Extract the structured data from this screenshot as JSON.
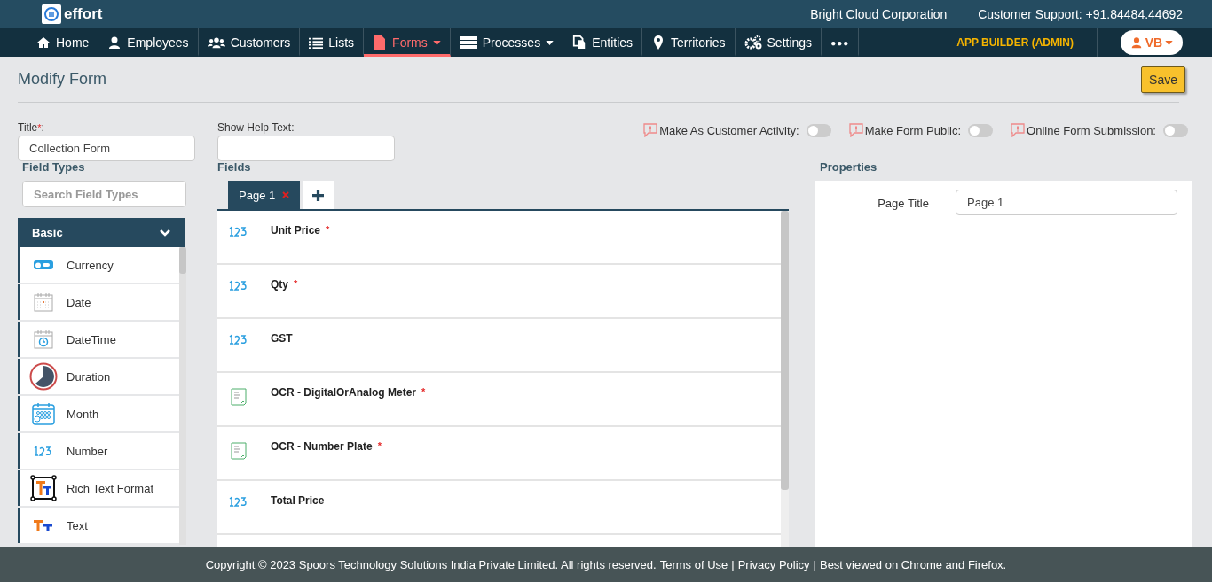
{
  "brand": {
    "name": "effort"
  },
  "header": {
    "company": "Bright Cloud Corporation",
    "support": "Customer Support: +91.84484.44692"
  },
  "nav": [
    {
      "label": "Home",
      "kind": "home",
      "selected": false,
      "dropdown": false
    },
    {
      "label": "Employees",
      "kind": "user",
      "selected": false,
      "dropdown": false
    },
    {
      "label": "Customers",
      "kind": "users",
      "selected": false,
      "dropdown": false
    },
    {
      "label": "Lists",
      "kind": "list",
      "selected": false,
      "dropdown": false
    },
    {
      "label": "Forms",
      "kind": "file",
      "selected": true,
      "dropdown": true
    },
    {
      "label": "Processes",
      "kind": "server",
      "selected": false,
      "dropdown": true
    },
    {
      "label": "Entities",
      "kind": "copy",
      "selected": false,
      "dropdown": false
    },
    {
      "label": "Territories",
      "kind": "pin",
      "selected": false,
      "dropdown": false
    },
    {
      "label": "Settings",
      "kind": "gears",
      "selected": false,
      "dropdown": false
    },
    {
      "label": "●●●",
      "kind": "more",
      "selected": false,
      "dropdown": false
    }
  ],
  "role": "APP BUILDER (ADMIN)",
  "user_menu": {
    "initials": "VB"
  },
  "page_title": "Modify Form",
  "save_button": "Save",
  "title_field": {
    "label": "Title",
    "required_mark": "*",
    "suffix": ":",
    "value": "Collection Form"
  },
  "help_field": {
    "label": "Show Help Text:"
  },
  "toggles": [
    {
      "label": "Make As Customer Activity:",
      "on": false
    },
    {
      "label": "Make Form Public:",
      "on": false
    },
    {
      "label": "Online Form Submission:",
      "on": false
    }
  ],
  "field_types": {
    "heading": "Field Types",
    "search_placeholder": "Search Field Types",
    "group": {
      "label": "Basic",
      "expanded": true
    },
    "items": [
      {
        "label": "Currency",
        "kind": "currency"
      },
      {
        "label": "Date",
        "kind": "date"
      },
      {
        "label": "DateTime",
        "kind": "datetime"
      },
      {
        "label": "Duration",
        "kind": "duration"
      },
      {
        "label": "Month",
        "kind": "month"
      },
      {
        "label": "Number",
        "kind": "number"
      },
      {
        "label": "Rich Text Format",
        "kind": "rich"
      },
      {
        "label": "Text",
        "kind": "text"
      }
    ]
  },
  "fields": {
    "heading": "Fields",
    "pages": [
      {
        "label": "Page 1",
        "selected": true
      }
    ],
    "rows": [
      {
        "label": "Unit Price",
        "kind": "number",
        "required": true
      },
      {
        "label": "Qty",
        "kind": "number",
        "required": true
      },
      {
        "label": "GST",
        "kind": "number",
        "required": false
      },
      {
        "label": "OCR - DigitalOrAnalog Meter",
        "kind": "ocr",
        "required": true
      },
      {
        "label": "OCR - Number Plate",
        "kind": "ocr",
        "required": true
      },
      {
        "label": "Total Price",
        "kind": "number",
        "required": false
      }
    ]
  },
  "properties": {
    "heading": "Properties",
    "page_title_label": "Page Title",
    "page_title_value": "Page 1"
  },
  "footer": [
    "Copyright © 2023 Spoors Technology Solutions India Private Limited. All rights reserved.",
    "Terms of Use",
    "|",
    "Privacy Policy",
    "|",
    "Best viewed on Chrome and Firefox."
  ]
}
